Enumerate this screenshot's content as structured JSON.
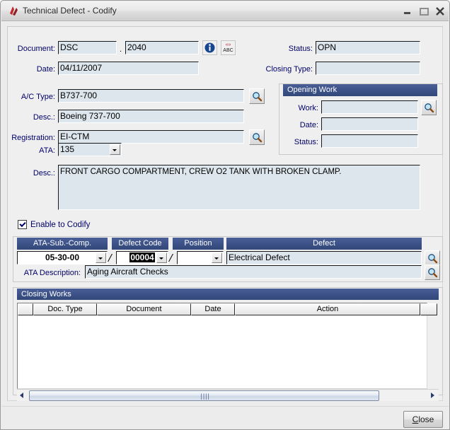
{
  "window": {
    "title": "Technical Defect - Codify",
    "app_icon": "app-logo-icon",
    "minimize_label": "–",
    "maximize_label": "□",
    "close_label": "✕"
  },
  "header": {
    "document_label": "Document:",
    "document_prefix": "DSC",
    "document_separator": ".",
    "document_number": "2040",
    "info_button": "info-icon",
    "spellcheck_button": "ABC",
    "date_label": "Date:",
    "date_value": "04/11/2007",
    "status_label": "Status:",
    "status_value": "OPN",
    "closing_type_label": "Closing Type:",
    "closing_type_value": ""
  },
  "aircraft": {
    "ac_type_label": "A/C Type:",
    "ac_type_value": "B737-700",
    "desc_label": "Desc.:",
    "desc_value": "Boeing 737-700",
    "registration_label": "Registration:",
    "registration_value": "EI-CTM",
    "ata_label": "ATA:",
    "ata_value": "135"
  },
  "opening_work": {
    "title": "Opening Work",
    "work_label": "Work:",
    "work_value": "",
    "date_label": "Date:",
    "date_value": "",
    "status_label": "Status:",
    "status_value": ""
  },
  "defect_description": {
    "label": "Desc.:",
    "value": "FRONT CARGO COMPARTMENT, CREW O2 TANK WITH BROKEN CLAMP."
  },
  "codify": {
    "enable_label": "Enable to Codify",
    "enable_checked": true,
    "columns": {
      "ata_sub_comp": "ATA-Sub.-Comp.",
      "defect_code": "Defect Code",
      "position": "Position",
      "defect": "Defect"
    },
    "ata_sub_comp_value": "05-30-00",
    "defect_code_value": "00004",
    "position_value": "",
    "defect_value": "Electrical Defect",
    "separator": "/",
    "ata_description_label": "ATA Description:",
    "ata_description_value": "Aging Aircraft Checks"
  },
  "closing_works": {
    "title": "Closing Works",
    "columns": [
      "Doc. Type",
      "Document",
      "Date",
      "Action"
    ],
    "rows": []
  },
  "footer": {
    "close_label": "Close",
    "close_accelerator": "C"
  },
  "colors": {
    "label_text": "#00006a",
    "field_bg": "#dce6ec",
    "section_bar": "#3c5288",
    "window_bg": "#ececec"
  }
}
